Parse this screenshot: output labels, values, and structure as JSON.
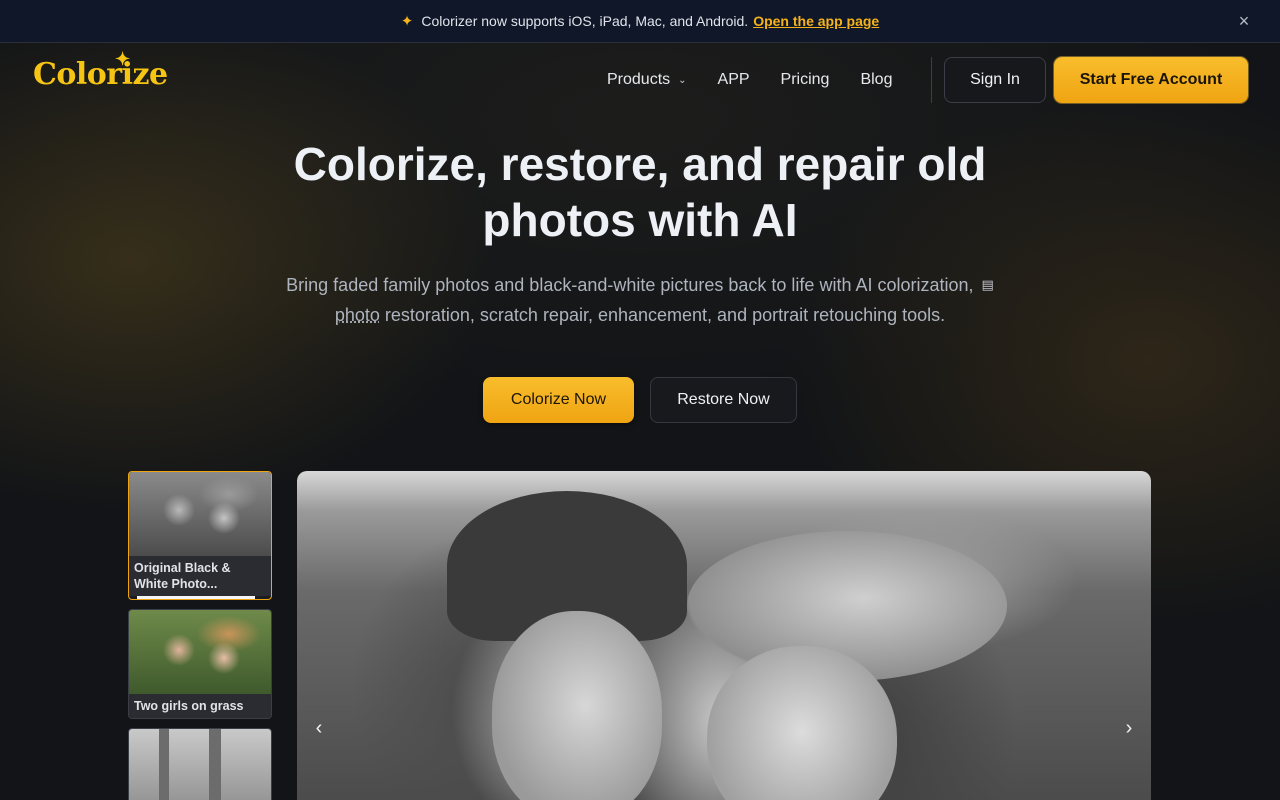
{
  "announcement": {
    "text": "Colorizer now supports iOS, iPad, Mac, and Android.",
    "link": "Open the app page",
    "spark_icon": "sparkles-icon",
    "close_icon": "×"
  },
  "header": {
    "logo": "Colorize",
    "nav": [
      "Products",
      "APP",
      "Pricing",
      "Blog"
    ],
    "sign_in": "Sign In",
    "start": "Start Free Account"
  },
  "hero": {
    "title": "Colorize, restore, and repair old photos with AI",
    "subtitle_before": "Bring faded family photos and black-and-white pictures back to life with AI colorization,",
    "subtitle_link": "photo",
    "subtitle_after": "restoration, scratch repair, enhancement, and portrait retouching tools.",
    "colorize_button": "Colorize Now",
    "restore_button": "Restore Now"
  },
  "gallery": {
    "thumbnails": [
      {
        "caption": "Original Black & White Photo...",
        "active": true
      },
      {
        "caption": "Two girls on grass",
        "active": false
      },
      {
        "caption": "",
        "active": false
      }
    ],
    "prev_icon": "‹",
    "next_icon": "›"
  },
  "colors": {
    "accent": "#f5b21a",
    "background": "#121417"
  }
}
